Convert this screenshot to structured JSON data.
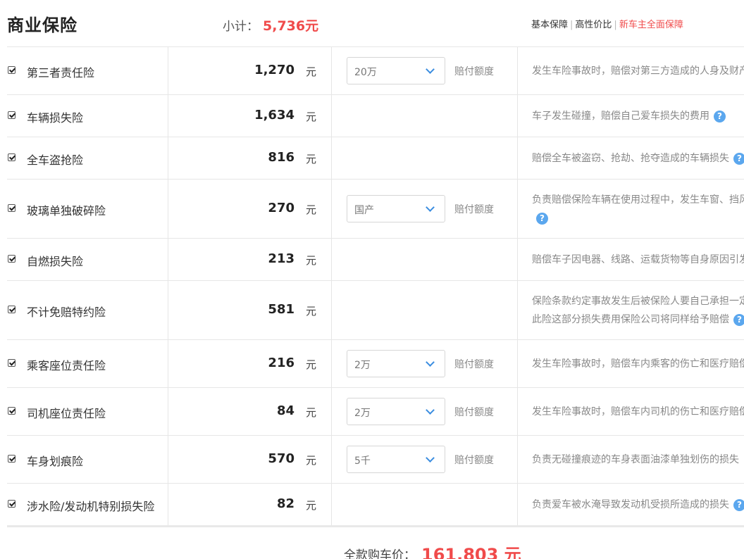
{
  "header": {
    "title": "商业保险",
    "subtotal_label": "小计：",
    "subtotal_value": "5,736元",
    "plans": [
      "基本保障",
      "高性价比",
      "新车主全面保障"
    ],
    "active_plan": "新车主全面保障"
  },
  "rows": [
    {
      "name": "第三者责任险",
      "checked": true,
      "price": "1,270",
      "unit": "元",
      "select": "20万",
      "select_label": "赔付额度",
      "desc": [
        "发生车险事故时，赔偿对第三方造成的人身及财产"
      ],
      "help": false
    },
    {
      "name": "车辆损失险",
      "checked": true,
      "price": "1,634",
      "unit": "元",
      "select": null,
      "select_label": null,
      "desc": [
        "车子发生碰撞，赔偿自己爱车损失的费用"
      ],
      "help": true
    },
    {
      "name": "全车盗抢险",
      "checked": true,
      "price": "816",
      "unit": "元",
      "select": null,
      "select_label": null,
      "desc": [
        "赔偿全车被盗窃、抢劫、抢夺造成的车辆损失"
      ],
      "help": true
    },
    {
      "name": "玻璃单独破碎险",
      "checked": true,
      "price": "270",
      "unit": "元",
      "select": "国产",
      "select_label": "赔付额度",
      "desc": [
        "负责赔偿保险车辆在使用过程中，发生车窗、挡风",
        ""
      ],
      "help": true
    },
    {
      "name": "自燃损失险",
      "checked": true,
      "price": "213",
      "unit": "元",
      "select": null,
      "select_label": null,
      "desc": [
        "赔偿车子因电器、线路、运载货物等自身原因引发"
      ],
      "help": false
    },
    {
      "name": "不计免赔特约险",
      "checked": true,
      "price": "581",
      "unit": "元",
      "select": null,
      "select_label": null,
      "desc": [
        "保险条款约定事故发生后被保险人要自己承担一定",
        "此险这部分损失费用保险公司将同样给予赔偿"
      ],
      "help": true
    },
    {
      "name": "乘客座位责任险",
      "checked": true,
      "price": "216",
      "unit": "元",
      "select": "2万",
      "select_label": "赔付额度",
      "desc": [
        "发生车险事故时，赔偿车内乘客的伤亡和医疗赔偿"
      ],
      "help": false
    },
    {
      "name": "司机座位责任险",
      "checked": true,
      "price": "84",
      "unit": "元",
      "select": "2万",
      "select_label": "赔付额度",
      "desc": [
        "发生车险事故时，赔偿车内司机的伤亡和医疗赔偿"
      ],
      "help": false
    },
    {
      "name": "车身划痕险",
      "checked": true,
      "price": "570",
      "unit": "元",
      "select": "5千",
      "select_label": "赔付额度",
      "desc": [
        "负责无碰撞痕迹的车身表面油漆单独划伤的损失"
      ],
      "help": false
    },
    {
      "name": "涉水险/发动机特别损失险",
      "checked": true,
      "price": "82",
      "unit": "元",
      "select": null,
      "select_label": null,
      "desc": [
        "负责爱车被水淹导致发动机受损所造成的损失"
      ],
      "help": true
    }
  ],
  "footer": {
    "total_label": "全款购车价：",
    "total_value": "161,803 元"
  },
  "colors": {
    "accent": "#f04b4b",
    "help": "#5ba7ee",
    "chevron": "#3a8de0"
  }
}
